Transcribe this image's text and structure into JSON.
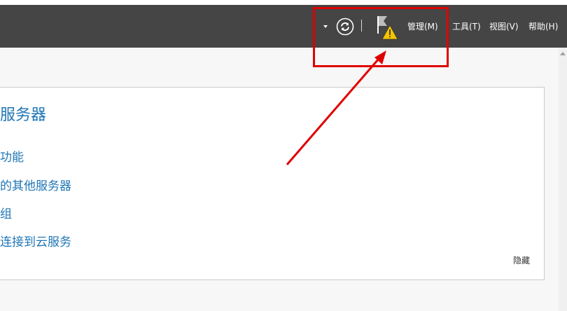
{
  "toolbar": {
    "menu": [
      {
        "label": "管理(M)"
      },
      {
        "label": "工具(T)"
      },
      {
        "label": "视图(V)"
      },
      {
        "label": "帮助(H)"
      }
    ]
  },
  "panel": {
    "title": "服务器",
    "links": [
      {
        "label": "功能"
      },
      {
        "label": "的其他服务器"
      },
      {
        "label": "组"
      },
      {
        "label": "连接到云服务"
      }
    ],
    "hide_label": "隐藏"
  },
  "colors": {
    "titlebar": "#454545",
    "link": "#1f76b6",
    "highlight": "#e00000",
    "warning": "#f5c400"
  }
}
